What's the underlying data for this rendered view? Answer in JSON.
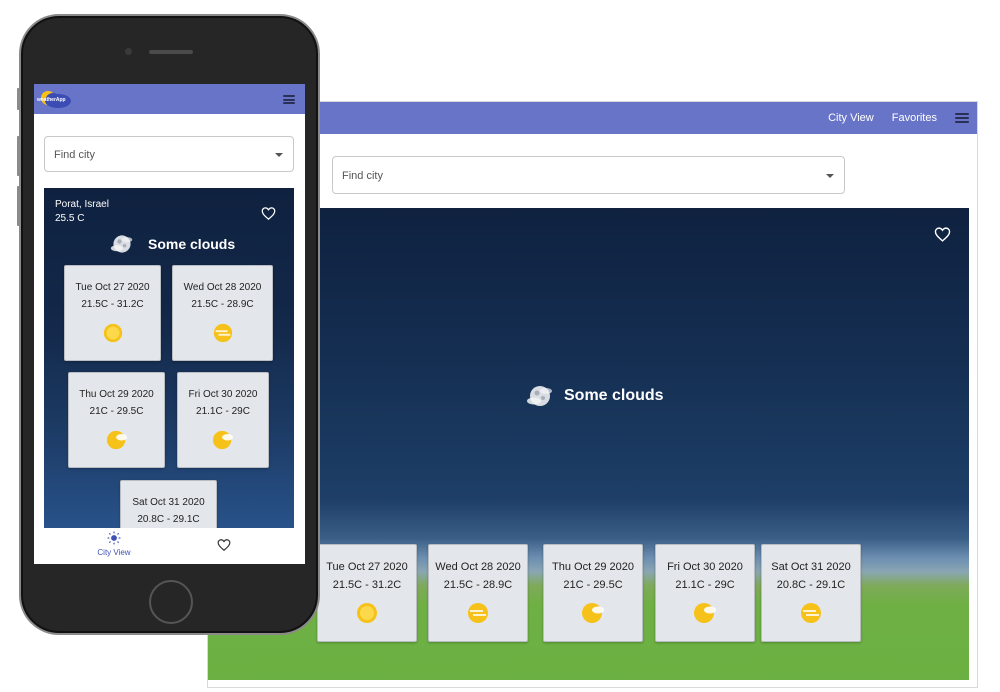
{
  "app": {
    "logo_text": "weatherApp"
  },
  "desktop": {
    "nav": {
      "city_view": "City View",
      "favorites": "Favorites"
    },
    "search": {
      "placeholder": "Find city"
    },
    "current": {
      "condition": "Some clouds"
    },
    "forecast": [
      {
        "date": "Tue Oct 27 2020",
        "range": "21.5C - 31.2C",
        "icon": "sun-icon"
      },
      {
        "date": "Wed Oct 28 2020",
        "range": "21.5C - 28.9C",
        "icon": "hazy-sun-icon"
      },
      {
        "date": "Thu Oct 29 2020",
        "range": "21C - 29.5C",
        "icon": "partly-cloudy-icon"
      },
      {
        "date": "Fri Oct 30 2020",
        "range": "21.1C - 29C",
        "icon": "partly-cloudy-icon"
      },
      {
        "date": "Sat Oct 31 2020",
        "range": "20.8C - 29.1C",
        "icon": "hazy-sun-icon"
      }
    ]
  },
  "mobile": {
    "search": {
      "placeholder": "Find city"
    },
    "current": {
      "city": "Porat, Israel",
      "temperature": "25.5 C",
      "condition": "Some clouds"
    },
    "forecast": [
      {
        "date": "Tue Oct 27 2020",
        "range": "21.5C - 31.2C",
        "icon": "sun-icon"
      },
      {
        "date": "Wed Oct 28 2020",
        "range": "21.5C - 28.9C",
        "icon": "hazy-sun-icon"
      },
      {
        "date": "Thu Oct 29 2020",
        "range": "21C - 29.5C",
        "icon": "partly-cloudy-icon"
      },
      {
        "date": "Fri Oct 30 2020",
        "range": "21.1C - 29C",
        "icon": "partly-cloudy-icon"
      },
      {
        "date": "Sat Oct 31 2020",
        "range": "20.8C - 29.1C",
        "icon": "hazy-sun-icon"
      }
    ],
    "bottom_nav": {
      "city_view": "City View"
    }
  },
  "colors": {
    "appbar": "#6874c8",
    "sky_top": "#0f213f",
    "grass": "#6bb042",
    "card": "#e3e6ea",
    "active_tab": "#3f51b5"
  }
}
